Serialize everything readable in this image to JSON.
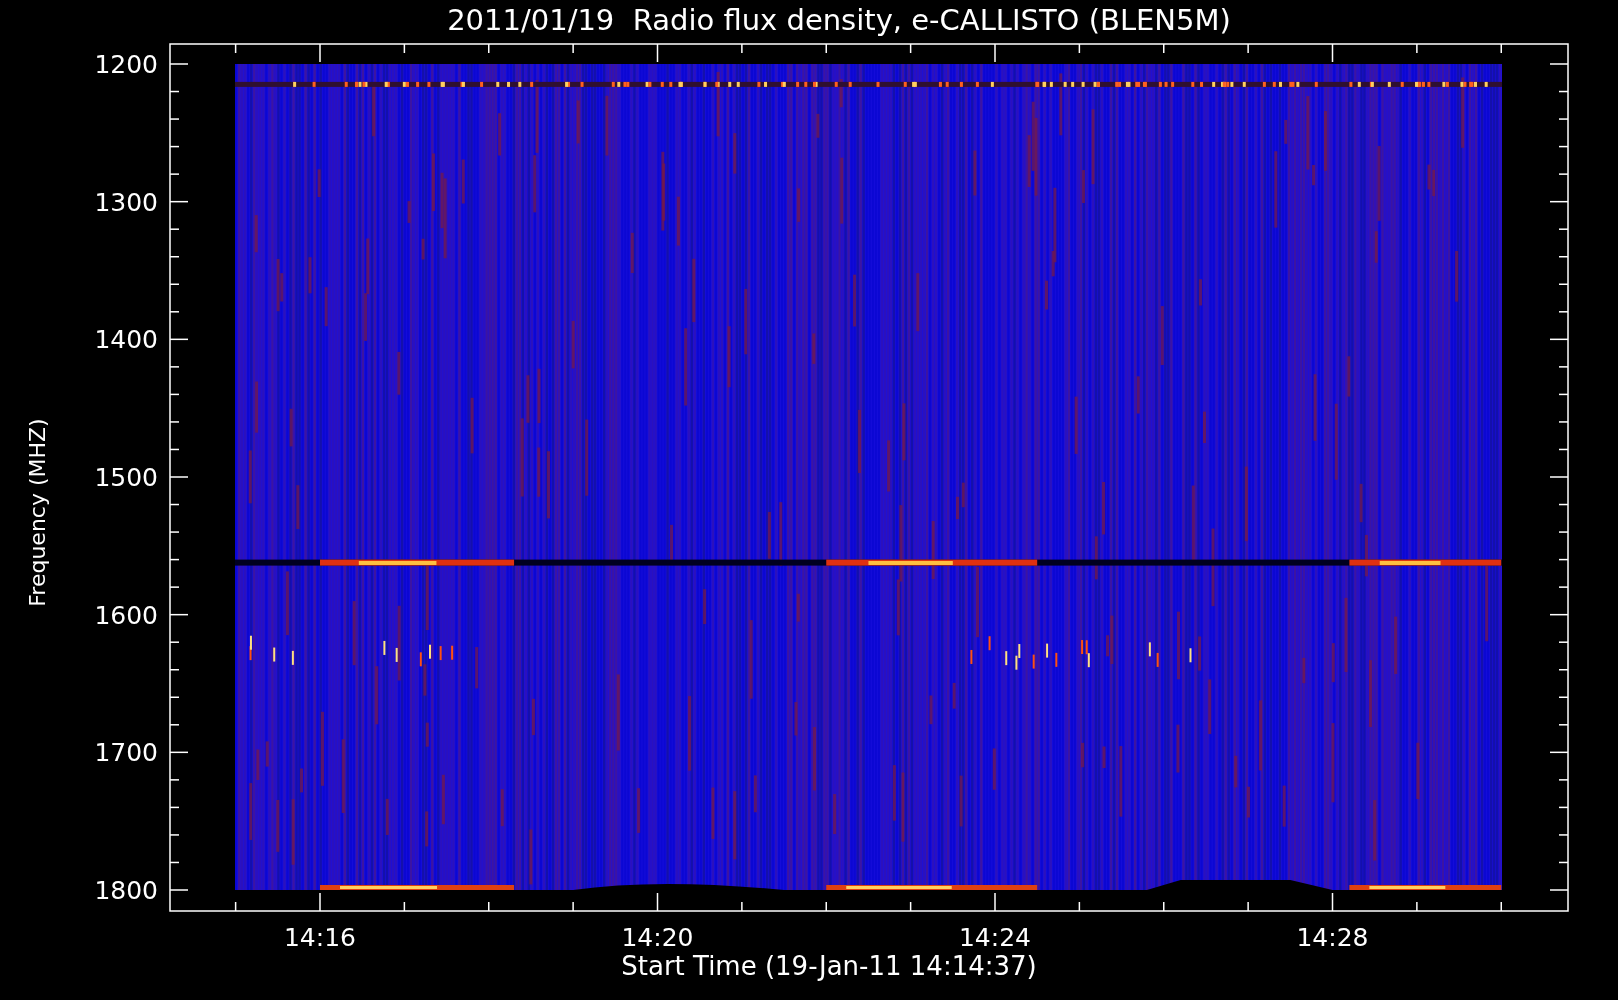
{
  "title": "2011/01/19  Radio flux density, e-CALLISTO (BLEN5M)",
  "y_axis": {
    "label": "Frequency (MHZ)",
    "ticks": [
      "1200",
      "1300",
      "1400",
      "1500",
      "1600",
      "1700",
      "1800"
    ]
  },
  "x_axis": {
    "label": "Start Time (19-Jan-11 14:14:37)",
    "ticks": [
      "14:16",
      "14:20",
      "14:24",
      "14:28"
    ]
  }
}
